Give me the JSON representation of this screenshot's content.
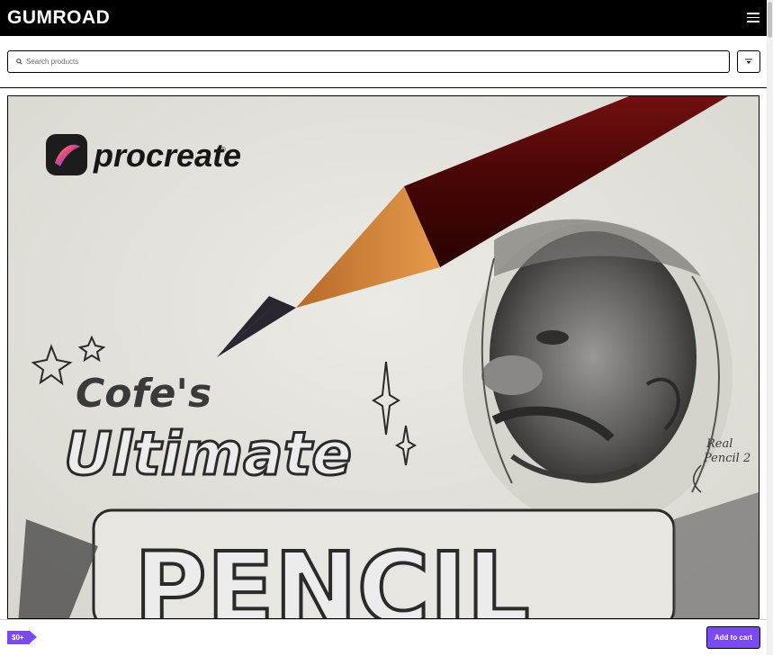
{
  "header": {
    "logo": "GUMROAD",
    "menu_icon": "hamburger-menu-icon"
  },
  "search": {
    "placeholder": "Search products",
    "value": "",
    "icon": "search-icon",
    "filter_icon": "filter-icon"
  },
  "product": {
    "image_text": {
      "brand": "procreate",
      "brand_mark": "®",
      "line1": "Cofe's",
      "line2": "Ultimate",
      "line3": "PENCIL",
      "note_line1": "Real",
      "note_line2": "Pencil 2"
    },
    "price": "$0+",
    "add_to_cart": "Add to cart"
  },
  "colors": {
    "header_bg": "#000000",
    "accent": "#7b49f5",
    "paper": "#e3e0da"
  }
}
